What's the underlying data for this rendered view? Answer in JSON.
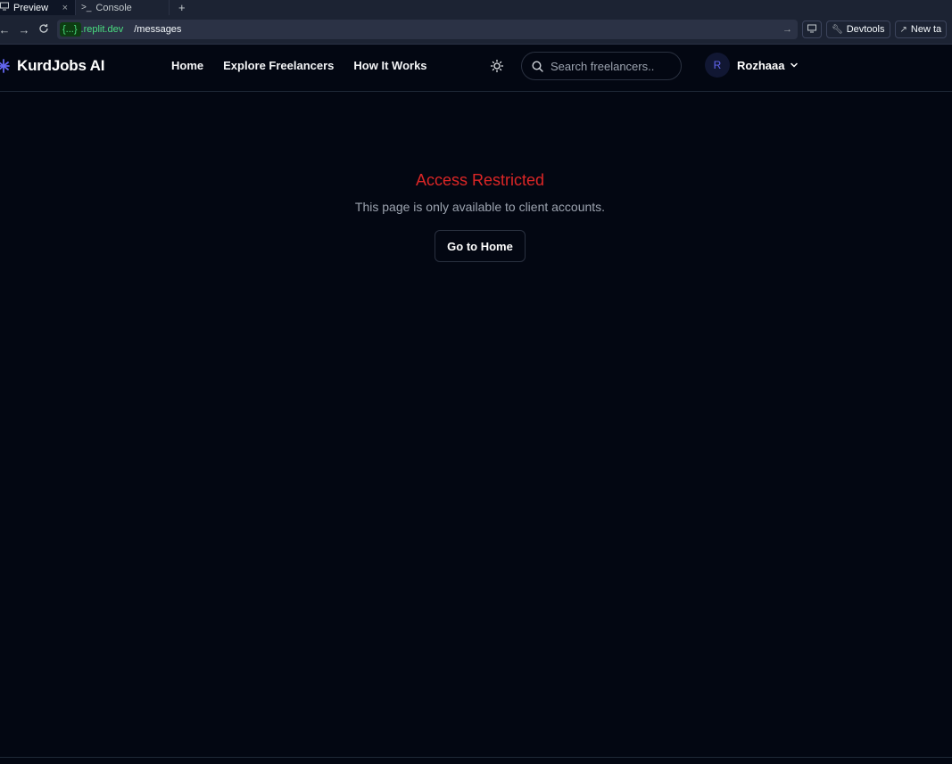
{
  "browser": {
    "tabs": [
      {
        "label": "Preview",
        "close": "×"
      },
      {
        "label": "Console"
      }
    ],
    "new_tab": "+",
    "url": {
      "domain_masked": "{...}",
      "domain_suffix": ".replit.dev",
      "path": "/messages"
    },
    "devtools_label": "Devtools",
    "new_tab_label": "New ta"
  },
  "header": {
    "brand": "KurdJobs AI",
    "nav": [
      "Home",
      "Explore Freelancers",
      "How It Works"
    ],
    "search_placeholder": "Search freelancers..",
    "user": {
      "initial": "R",
      "name": "Rozhaaa"
    }
  },
  "main": {
    "title": "Access Restricted",
    "description": "This page is only available to client accounts.",
    "button_label": "Go to Home"
  },
  "colors": {
    "background": "#030712",
    "error": "#dc2626",
    "brand_icon": "#6366f1",
    "replit_green": "#4ade80"
  },
  "icons": [
    "monitor-icon",
    "terminal-icon",
    "back-arrow-icon",
    "forward-arrow-icon",
    "refresh-icon",
    "wrench-icon",
    "external-link-icon",
    "sun-icon",
    "search-icon",
    "chevron-down-icon"
  ]
}
